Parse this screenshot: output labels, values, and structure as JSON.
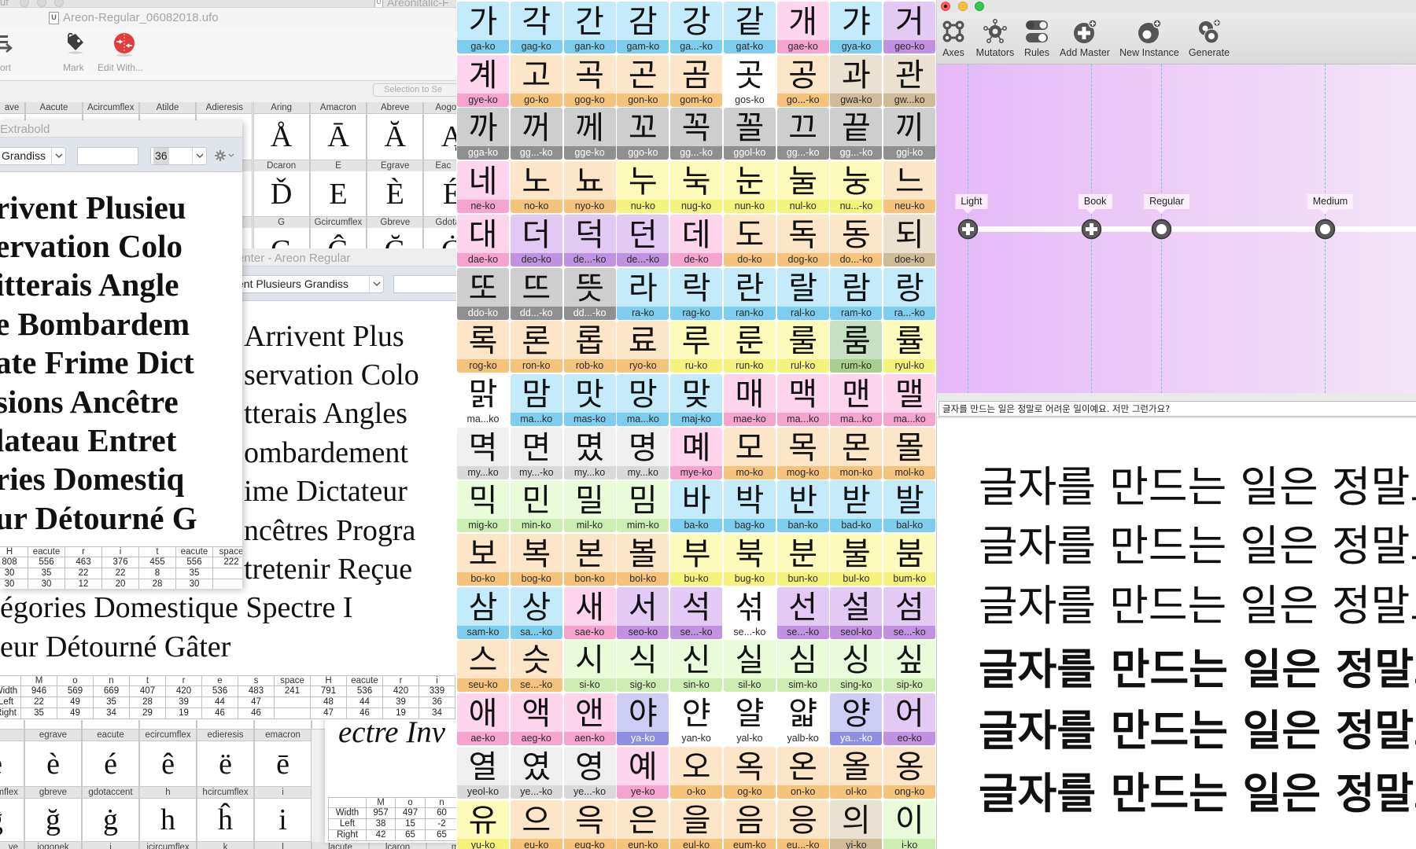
{
  "back_window": {
    "title_fragment": "uf",
    "italic_title": "Areonitalic-F"
  },
  "font_window": {
    "title": "Areon-Regular_06082018.ufo",
    "toolbar": {
      "sort": "ort",
      "mark": "Mark",
      "edit_with": "Edit With..."
    },
    "selection_button": "Selection to Se",
    "glyph_grid": [
      {
        "headers": [
          "ave",
          "Aacute",
          "Acircumflex",
          "Atilde",
          "Adieresis",
          "Aring",
          "Amacron",
          "Abreve",
          "Aogo"
        ],
        "glyphs": [
          "",
          "",
          "",
          "",
          "",
          "Å",
          "Ā",
          "Ă",
          "Ą"
        ]
      },
      {
        "headers": [
          "",
          "",
          "",
          "",
          "",
          "Dcaron",
          "E",
          "Egrave",
          "Eac"
        ],
        "glyphs": [
          "",
          "",
          "",
          "",
          "",
          "Ď",
          "E",
          "È",
          "É"
        ]
      },
      {
        "headers": [
          "",
          "",
          "",
          "",
          "",
          "G",
          "Gcircumflex",
          "Gbreve",
          "Gdota"
        ],
        "glyphs": [
          "",
          "",
          "",
          "",
          "",
          "G",
          "Ĝ",
          "Ğ",
          "Ġ"
        ]
      }
    ]
  },
  "extrabold_window": {
    "title": "Extrabold",
    "text_select": "Grandiss",
    "text_input": "",
    "size_value": "36",
    "lines": [
      "rivent Plusieu",
      "ervation Colo",
      "itterais Angle",
      "e Bombardem",
      "ate Frime Dict",
      "sions Ancêtre",
      "lateau Entret",
      "ries Domestiq",
      "ur Détourné G"
    ],
    "metrics": {
      "glyphs": [
        "H",
        "eacute",
        "r",
        "i",
        "t",
        "eacute",
        "space"
      ],
      "width": [
        "808",
        "556",
        "463",
        "376",
        "455",
        "556",
        "222"
      ],
      "left": [
        "30",
        "35",
        "22",
        "22",
        "8",
        "35",
        ""
      ],
      "right": [
        "30",
        "30",
        "12",
        "20",
        "28",
        "30",
        ""
      ]
    }
  },
  "regular_window": {
    "title": "enter - Areon Regular",
    "text_select": "ent Plusieurs Grandiss",
    "text_input": "",
    "lines": [
      "Arrivent Plus",
      "servation Colo",
      "tterais Angles",
      "ombardement",
      "ime Dictateur",
      "ncêtres Progra",
      "tretenir Reçue",
      "égories Domestique Spectre I",
      "eur Détourné Gâter"
    ],
    "metrics": {
      "row_labels": [
        "Width",
        "Left",
        "Right"
      ],
      "glyphs": [
        "M",
        "o",
        "n",
        "t",
        "r",
        "e",
        "s",
        "space",
        "H",
        "eacute",
        "r",
        "i"
      ],
      "width": [
        "946",
        "569",
        "669",
        "407",
        "420",
        "536",
        "483",
        "241",
        "791",
        "536",
        "420",
        "339"
      ],
      "left": [
        "22",
        "49",
        "35",
        "28",
        "39",
        "44",
        "47",
        "",
        "48",
        "44",
        "39",
        "36"
      ],
      "right": [
        "35",
        "49",
        "34",
        "29",
        "19",
        "46",
        "46",
        "",
        "47",
        "46",
        "19",
        "34"
      ]
    }
  },
  "italic_window": {
    "lines": [
      "ectre Inv"
    ],
    "metrics": {
      "row_labels": [
        "Width",
        "Left",
        "Right"
      ],
      "glyphs": [
        "M",
        "o",
        "n"
      ],
      "width": [
        "957",
        "497",
        "60"
      ],
      "left": [
        "38",
        "15",
        "-2"
      ],
      "right": [
        "42",
        "65",
        "65"
      ]
    }
  },
  "bottom_glyph_grid": [
    {
      "headers": [
        "",
        "egrave",
        "eacute",
        "ecircumflex",
        "edieresis",
        "emacron"
      ],
      "glyphs": [
        "e",
        "è",
        "é",
        "ê",
        "ë",
        "ē"
      ]
    },
    {
      "headers": [
        "mflex",
        "gbreve",
        "gdotaccent",
        "h",
        "hcircumflex",
        "i"
      ],
      "glyphs": [
        "ĝ",
        "ğ",
        "ġ",
        "h",
        "ĥ",
        "i"
      ]
    },
    {
      "headers": [
        "ve",
        "iogonek",
        "j",
        "jcircumflex",
        "k",
        "l",
        "lacute",
        "lcaron",
        "m"
      ]
    }
  ],
  "hangul_grid": {
    "mark_colors": {
      "blue": {
        "fill": "#c3ebfb",
        "label": "#7fcdee",
        "text": "#2b2b2b"
      },
      "pink": {
        "fill": "#fed5ec",
        "label": "#f5a3cf",
        "text": "#2b2b2b"
      },
      "purple": {
        "fill": "#e3caf4",
        "label": "#c192e2",
        "text": "#2b2b2b"
      },
      "orange": {
        "fill": "#fde6c7",
        "label": "#f5c37c",
        "text": "#2b2b2b"
      },
      "white": {
        "fill": "#ffffff",
        "label": "#ffffff",
        "text": "#2b2b2b"
      },
      "tan": {
        "fill": "#ebe1d0",
        "label": "#cfbb98",
        "text": "#2b2b2b"
      },
      "gray": {
        "fill": "#cecece",
        "label": "#8f8f8f",
        "text": "#ffffff"
      },
      "yellow": {
        "fill": "#fdfbbb",
        "label": "#f6f27e",
        "text": "#2b2b2b"
      },
      "green": {
        "fill": "#c6e0c2",
        "label": "#a9cf8f",
        "text": "#2b2b2b"
      },
      "lightgray": {
        "fill": "#efefef",
        "label": "#d9d9d9",
        "text": "#2b2b2b"
      },
      "lightgreen": {
        "fill": "#e9fbd8",
        "label": "#cdeeb3",
        "text": "#2b2b2b"
      },
      "indigo": {
        "fill": "#cdcdf6",
        "label": "#8f8fe2",
        "text": "#ffffff"
      }
    },
    "cells": [
      [
        "가",
        "ga-ko",
        "blue"
      ],
      [
        "각",
        "gag-ko",
        "blue"
      ],
      [
        "간",
        "gan-ko",
        "blue"
      ],
      [
        "감",
        "gam-ko",
        "blue"
      ],
      [
        "강",
        "ga...-ko",
        "blue"
      ],
      [
        "같",
        "gat-ko",
        "blue"
      ],
      [
        "개",
        "gae-ko",
        "pink"
      ],
      [
        "갸",
        "gya-ko",
        "blue"
      ],
      [
        "거",
        "geo-ko",
        "purple"
      ],
      [
        "계",
        "gye-ko",
        "pink"
      ],
      [
        "고",
        "go-ko",
        "orange"
      ],
      [
        "곡",
        "gog-ko",
        "orange"
      ],
      [
        "곤",
        "gon-ko",
        "orange"
      ],
      [
        "곰",
        "gom-ko",
        "orange"
      ],
      [
        "곳",
        "gos-ko",
        "white"
      ],
      [
        "공",
        "go...-ko",
        "orange"
      ],
      [
        "과",
        "gwa-ko",
        "tan"
      ],
      [
        "관",
        "gw...ko",
        "tan"
      ],
      [
        "까",
        "gga-ko",
        "gray"
      ],
      [
        "꺼",
        "gg...-ko",
        "gray"
      ],
      [
        "께",
        "gge-ko",
        "gray"
      ],
      [
        "꼬",
        "ggo-ko",
        "gray"
      ],
      [
        "꼭",
        "gg...-ko",
        "gray"
      ],
      [
        "꼴",
        "ggol-ko",
        "gray"
      ],
      [
        "끄",
        "gg...-ko",
        "gray"
      ],
      [
        "끝",
        "gg...-ko",
        "gray"
      ],
      [
        "끼",
        "ggi-ko",
        "gray"
      ],
      [
        "네",
        "ne-ko",
        "pink"
      ],
      [
        "노",
        "no-ko",
        "orange"
      ],
      [
        "뇨",
        "nyo-ko",
        "orange"
      ],
      [
        "누",
        "nu-ko",
        "yellow"
      ],
      [
        "눅",
        "nug-ko",
        "yellow"
      ],
      [
        "눈",
        "nun-ko",
        "yellow"
      ],
      [
        "눌",
        "nul-ko",
        "yellow"
      ],
      [
        "눙",
        "nu...-ko",
        "yellow"
      ],
      [
        "느",
        "neu-ko",
        "orange"
      ],
      [
        "대",
        "dae-ko",
        "pink"
      ],
      [
        "더",
        "deo-ko",
        "purple"
      ],
      [
        "덕",
        "de...-ko",
        "purple"
      ],
      [
        "던",
        "de...-ko",
        "purple"
      ],
      [
        "데",
        "de-ko",
        "pink"
      ],
      [
        "도",
        "do-ko",
        "orange"
      ],
      [
        "독",
        "dog-ko",
        "orange"
      ],
      [
        "동",
        "do...-ko",
        "orange"
      ],
      [
        "되",
        "doe-ko",
        "tan"
      ],
      [
        "또",
        "ddo-ko",
        "gray"
      ],
      [
        "뜨",
        "dd...-ko",
        "gray"
      ],
      [
        "뜻",
        "dd...-ko",
        "gray"
      ],
      [
        "라",
        "ra-ko",
        "blue"
      ],
      [
        "락",
        "rag-ko",
        "blue"
      ],
      [
        "란",
        "ran-ko",
        "blue"
      ],
      [
        "랄",
        "ral-ko",
        "blue"
      ],
      [
        "람",
        "ram-ko",
        "blue"
      ],
      [
        "랑",
        "ra...-ko",
        "blue"
      ],
      [
        "록",
        "rog-ko",
        "orange"
      ],
      [
        "론",
        "ron-ko",
        "orange"
      ],
      [
        "롭",
        "rob-ko",
        "orange"
      ],
      [
        "료",
        "ryo-ko",
        "orange"
      ],
      [
        "루",
        "ru-ko",
        "yellow"
      ],
      [
        "룬",
        "run-ko",
        "yellow"
      ],
      [
        "룰",
        "rul-ko",
        "yellow"
      ],
      [
        "룸",
        "rum-ko",
        "green"
      ],
      [
        "률",
        "ryul-ko",
        "yellow"
      ],
      [
        "맑",
        "ma...ko",
        "white"
      ],
      [
        "맘",
        "ma...ko",
        "blue"
      ],
      [
        "맛",
        "mas-ko",
        "blue"
      ],
      [
        "망",
        "ma...ko",
        "blue"
      ],
      [
        "맞",
        "maj-ko",
        "blue"
      ],
      [
        "매",
        "mae-ko",
        "pink"
      ],
      [
        "맥",
        "ma...ko",
        "pink"
      ],
      [
        "맨",
        "ma...ko",
        "pink"
      ],
      [
        "맬",
        "ma...ko",
        "pink"
      ],
      [
        "멱",
        "my...ko",
        "lightgray"
      ],
      [
        "면",
        "my...-ko",
        "lightgray"
      ],
      [
        "몄",
        "my...ko",
        "lightgray"
      ],
      [
        "명",
        "my...ko",
        "lightgray"
      ],
      [
        "몌",
        "mye-ko",
        "pink"
      ],
      [
        "모",
        "mo-ko",
        "orange"
      ],
      [
        "목",
        "mog-ko",
        "orange"
      ],
      [
        "몬",
        "mon-ko",
        "orange"
      ],
      [
        "몰",
        "mol-ko",
        "orange"
      ],
      [
        "믹",
        "mig-ko",
        "lightgreen"
      ],
      [
        "민",
        "min-ko",
        "lightgreen"
      ],
      [
        "밀",
        "mil-ko",
        "lightgreen"
      ],
      [
        "밈",
        "mim-ko",
        "lightgreen"
      ],
      [
        "바",
        "ba-ko",
        "blue"
      ],
      [
        "박",
        "bag-ko",
        "blue"
      ],
      [
        "반",
        "ban-ko",
        "blue"
      ],
      [
        "받",
        "bad-ko",
        "blue"
      ],
      [
        "발",
        "bal-ko",
        "blue"
      ],
      [
        "보",
        "bo-ko",
        "orange"
      ],
      [
        "복",
        "bog-ko",
        "orange"
      ],
      [
        "본",
        "bon-ko",
        "orange"
      ],
      [
        "볼",
        "bol-ko",
        "orange"
      ],
      [
        "부",
        "bu-ko",
        "yellow"
      ],
      [
        "북",
        "bug-ko",
        "yellow"
      ],
      [
        "분",
        "bun-ko",
        "yellow"
      ],
      [
        "불",
        "bul-ko",
        "yellow"
      ],
      [
        "붐",
        "bum-ko",
        "yellow"
      ],
      [
        "삼",
        "sam-ko",
        "blue"
      ],
      [
        "상",
        "sa...-ko",
        "blue"
      ],
      [
        "새",
        "sae-ko",
        "pink"
      ],
      [
        "서",
        "seo-ko",
        "purple"
      ],
      [
        "석",
        "se...-ko",
        "purple"
      ],
      [
        "섞",
        "se...-ko",
        "white"
      ],
      [
        "선",
        "se...-ko",
        "purple"
      ],
      [
        "설",
        "seol-ko",
        "purple"
      ],
      [
        "섬",
        "se...-ko",
        "purple"
      ],
      [
        "스",
        "seu-ko",
        "orange"
      ],
      [
        "슷",
        "se...-ko",
        "orange"
      ],
      [
        "시",
        "si-ko",
        "lightgreen"
      ],
      [
        "식",
        "sig-ko",
        "lightgreen"
      ],
      [
        "신",
        "sin-ko",
        "lightgreen"
      ],
      [
        "실",
        "sil-ko",
        "lightgreen"
      ],
      [
        "심",
        "sim-ko",
        "lightgreen"
      ],
      [
        "싱",
        "sing-ko",
        "lightgreen"
      ],
      [
        "싶",
        "sip-ko",
        "lightgreen"
      ],
      [
        "애",
        "ae-ko",
        "pink"
      ],
      [
        "액",
        "aeg-ko",
        "pink"
      ],
      [
        "앤",
        "aen-ko",
        "pink"
      ],
      [
        "야",
        "ya-ko",
        "indigo"
      ],
      [
        "얀",
        "yan-ko",
        "white"
      ],
      [
        "얄",
        "yal-ko",
        "white"
      ],
      [
        "얇",
        "yalb-ko",
        "white"
      ],
      [
        "양",
        "ya...-ko",
        "indigo"
      ],
      [
        "어",
        "eo-ko",
        "purple"
      ],
      [
        "열",
        "yeol-ko",
        "lightgray"
      ],
      [
        "였",
        "ye...-ko",
        "lightgray"
      ],
      [
        "영",
        "ye...-ko",
        "lightgray"
      ],
      [
        "예",
        "ye-ko",
        "pink"
      ],
      [
        "오",
        "o-ko",
        "orange"
      ],
      [
        "옥",
        "og-ko",
        "orange"
      ],
      [
        "온",
        "on-ko",
        "orange"
      ],
      [
        "올",
        "ol-ko",
        "orange"
      ],
      [
        "옹",
        "ong-ko",
        "orange"
      ],
      [
        "유",
        "yu-ko",
        "yellow"
      ],
      [
        "으",
        "eu-ko",
        "orange"
      ],
      [
        "윽",
        "eug-ko",
        "orange"
      ],
      [
        "은",
        "eun-ko",
        "orange"
      ],
      [
        "을",
        "eul-ko",
        "orange"
      ],
      [
        "음",
        "eum-ko",
        "orange"
      ],
      [
        "응",
        "eu...-ko",
        "orange"
      ],
      [
        "의",
        "yi-ko",
        "tan"
      ],
      [
        "이",
        "i-ko",
        "lightgreen"
      ]
    ]
  },
  "designspace": {
    "toolbar": [
      "Axes",
      "Mutators",
      "Rules",
      "Add Master",
      "New Instance",
      "Generate"
    ],
    "masters": [
      {
        "name": "Light",
        "marker": "plus",
        "axis_position": 0.0
      },
      {
        "name": "Book",
        "marker": "plus",
        "axis_position": 0.275
      },
      {
        "name": "Regular",
        "marker": "ring",
        "axis_position": 0.431
      },
      {
        "name": "Medium",
        "marker": "ring",
        "axis_position": 0.795
      }
    ],
    "preview_input": "글자를 만드는 일은 정말로 어려운 일이예요. 저만 그런가요?"
  }
}
